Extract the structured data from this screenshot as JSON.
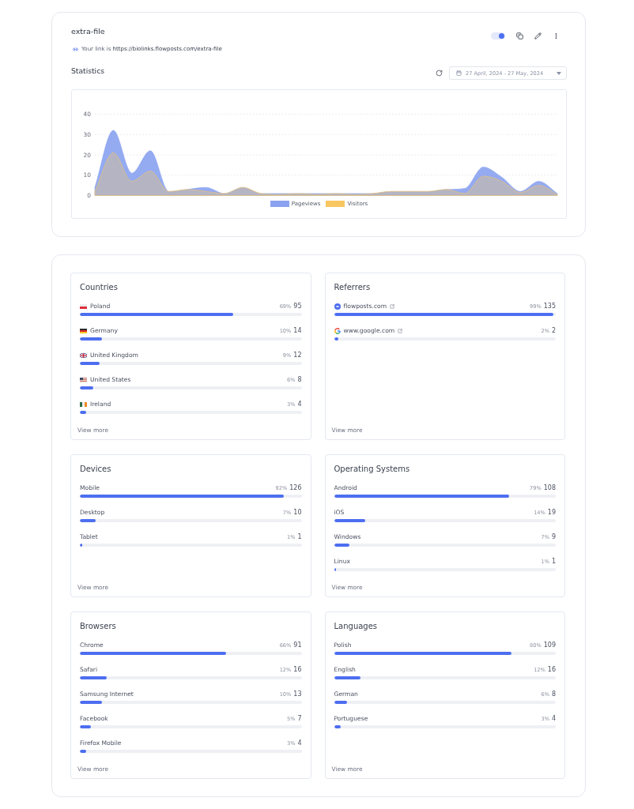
{
  "header": {
    "title": "extra-file",
    "link_prefix": "Your link is",
    "link_url": "https://biolinks.flowposts.com/extra-file",
    "toggle": {
      "on": true
    }
  },
  "statistics": {
    "title": "Statistics",
    "date_range": "27 April, 2024 - 27 May, 2024",
    "chart_data": {
      "type": "area",
      "grid": true,
      "legend": "bottom",
      "ylim": [
        0,
        40
      ],
      "yticks": [
        0,
        10,
        20,
        30,
        40
      ],
      "series": [
        {
          "name": "Pageviews",
          "color": "#8aa2f0",
          "values": [
            4,
            32,
            11,
            22,
            2,
            3,
            4,
            1,
            4,
            1,
            1,
            1,
            1,
            1,
            1,
            1,
            2,
            2,
            2,
            3,
            3.5,
            14,
            9,
            2,
            7,
            1
          ]
        },
        {
          "name": "Visitors",
          "color": "#f8c762",
          "values": [
            2,
            21,
            7,
            12,
            2,
            3,
            2,
            1,
            4,
            1,
            0.5,
            1,
            0.5,
            1,
            0.5,
            1,
            2,
            2,
            2,
            3,
            1,
            9.5,
            7,
            1.5,
            5,
            0.5
          ]
        }
      ]
    }
  },
  "panels": [
    {
      "title": "Countries",
      "items": [
        {
          "kind": "poland",
          "label": "Poland",
          "percent": "69%",
          "count": "95",
          "level": 0.69
        },
        {
          "kind": "germany",
          "label": "Germany",
          "percent": "10%",
          "count": "14",
          "level": 0.1
        },
        {
          "kind": "uk",
          "label": "United Kingdom",
          "percent": "9%",
          "count": "12",
          "level": 0.09
        },
        {
          "kind": "usa",
          "label": "United States",
          "percent": "6%",
          "count": "8",
          "level": 0.06
        },
        {
          "kind": "ireland",
          "label": "Ireland",
          "percent": "3%",
          "count": "4",
          "level": 0.03
        }
      ],
      "view_more": "View more"
    },
    {
      "title": "Referrers",
      "items": [
        {
          "kind": "site",
          "label": "flowposts.com",
          "percent": "99%",
          "count": "135",
          "level": 0.99
        },
        {
          "kind": "google",
          "label": "www.google.com",
          "percent": "2%",
          "count": "2",
          "level": 0.02
        }
      ],
      "view_more": "View more"
    },
    {
      "title": "Devices",
      "items": [
        {
          "label": "Mobile",
          "percent": "92%",
          "count": "126",
          "level": 0.92
        },
        {
          "label": "Desktop",
          "percent": "7%",
          "count": "10",
          "level": 0.07
        },
        {
          "label": "Tablet",
          "percent": "1%",
          "count": "1",
          "level": 0.01
        }
      ],
      "view_more": "View more"
    },
    {
      "title": "Operating Systems",
      "items": [
        {
          "label": "Android",
          "percent": "79%",
          "count": "108",
          "level": 0.79
        },
        {
          "label": "iOS",
          "percent": "14%",
          "count": "19",
          "level": 0.14
        },
        {
          "label": "Windows",
          "percent": "7%",
          "count": "9",
          "level": 0.07
        },
        {
          "label": "Linux",
          "percent": "1%",
          "count": "1",
          "level": 0.01
        }
      ],
      "view_more": "View more"
    },
    {
      "title": "Browsers",
      "items": [
        {
          "label": "Chrome",
          "percent": "66%",
          "count": "91",
          "level": 0.66
        },
        {
          "label": "Safari",
          "percent": "12%",
          "count": "16",
          "level": 0.12
        },
        {
          "label": "Samsung Internet",
          "percent": "10%",
          "count": "13",
          "level": 0.1
        },
        {
          "label": "Facebook",
          "percent": "5%",
          "count": "7",
          "level": 0.05
        },
        {
          "label": "Firefox Mobile",
          "percent": "3%",
          "count": "4",
          "level": 0.03
        }
      ],
      "view_more": "View more"
    },
    {
      "title": "Languages",
      "items": [
        {
          "label": "Polish",
          "percent": "80%",
          "count": "109",
          "level": 0.8
        },
        {
          "label": "English",
          "percent": "12%",
          "count": "16",
          "level": 0.12
        },
        {
          "label": "German",
          "percent": "6%",
          "count": "8",
          "level": 0.06
        },
        {
          "label": "Portuguese",
          "percent": "3%",
          "count": "4",
          "level": 0.03
        }
      ],
      "view_more": "View more"
    }
  ]
}
